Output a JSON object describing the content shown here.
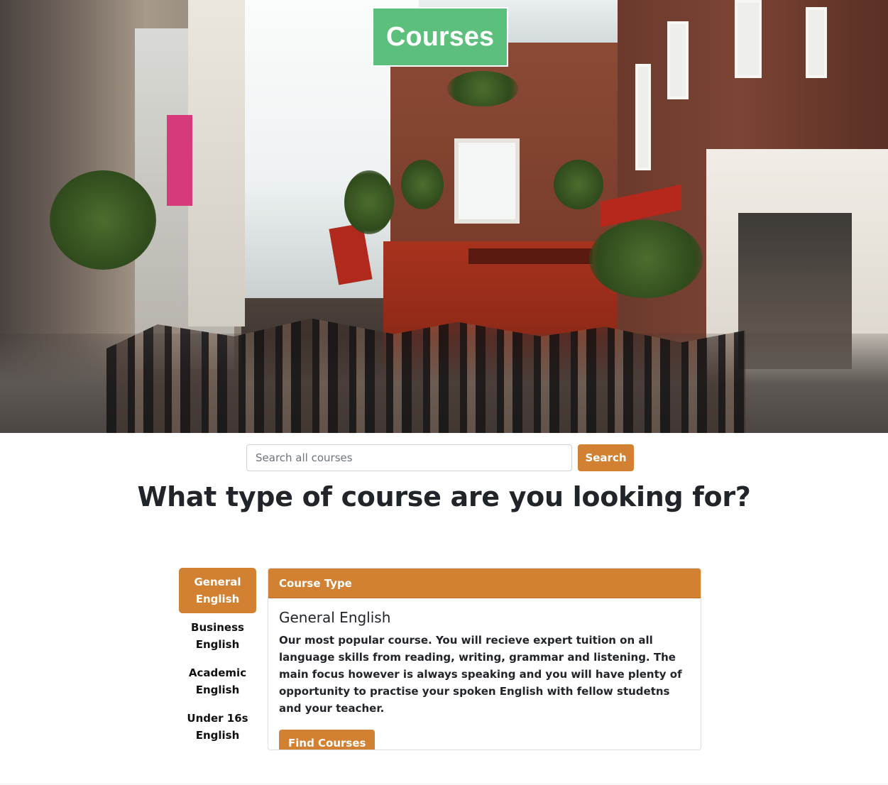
{
  "hero": {
    "title": "Courses"
  },
  "search": {
    "placeholder": "Search all courses",
    "button_label": "Search"
  },
  "question": "What type of course are you looking for?",
  "course_types": [
    {
      "label": "General English",
      "active": true
    },
    {
      "label": "Business English",
      "active": false
    },
    {
      "label": "Academic English",
      "active": false
    },
    {
      "label": "Under 16s English",
      "active": false
    }
  ],
  "card": {
    "header": "Course Type",
    "title": "General English",
    "description": "Our most popular course. You will recieve expert tuition on all language skills from reading, writing, grammar and listening. The main focus however is always speaking and you will have plenty of opportunity to practise your spoken English with fellow studetns and your teacher.",
    "button_label": "Find Courses"
  },
  "colors": {
    "accent": "#d28031",
    "title_bg": "#5cc07c"
  }
}
